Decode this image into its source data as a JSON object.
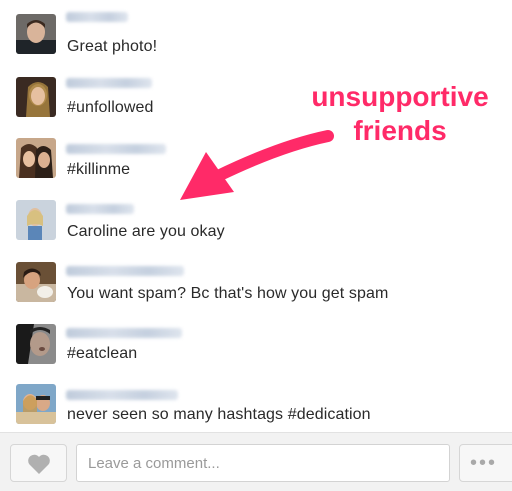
{
  "comments": [
    {
      "text": "Great photo!",
      "avatar": "avatar-1"
    },
    {
      "text": "#unfollowed",
      "avatar": "avatar-2"
    },
    {
      "text": "#killinme",
      "avatar": "avatar-3"
    },
    {
      "text": "Caroline are you okay",
      "avatar": "avatar-4"
    },
    {
      "text": "You want spam? Bc that's how you get spam",
      "avatar": "avatar-5"
    },
    {
      "text": "#eatclean",
      "avatar": "avatar-6"
    },
    {
      "text": "never seen so many hashtags #dedication",
      "avatar": "avatar-7"
    }
  ],
  "annotation": {
    "line1": "unsupportive",
    "line2": "friends",
    "color": "#ff2a68"
  },
  "bottom_bar": {
    "comment_placeholder": "Leave a comment...",
    "like_icon": "heart-icon",
    "more_icon": "ellipsis-icon",
    "more_label": "•••"
  }
}
